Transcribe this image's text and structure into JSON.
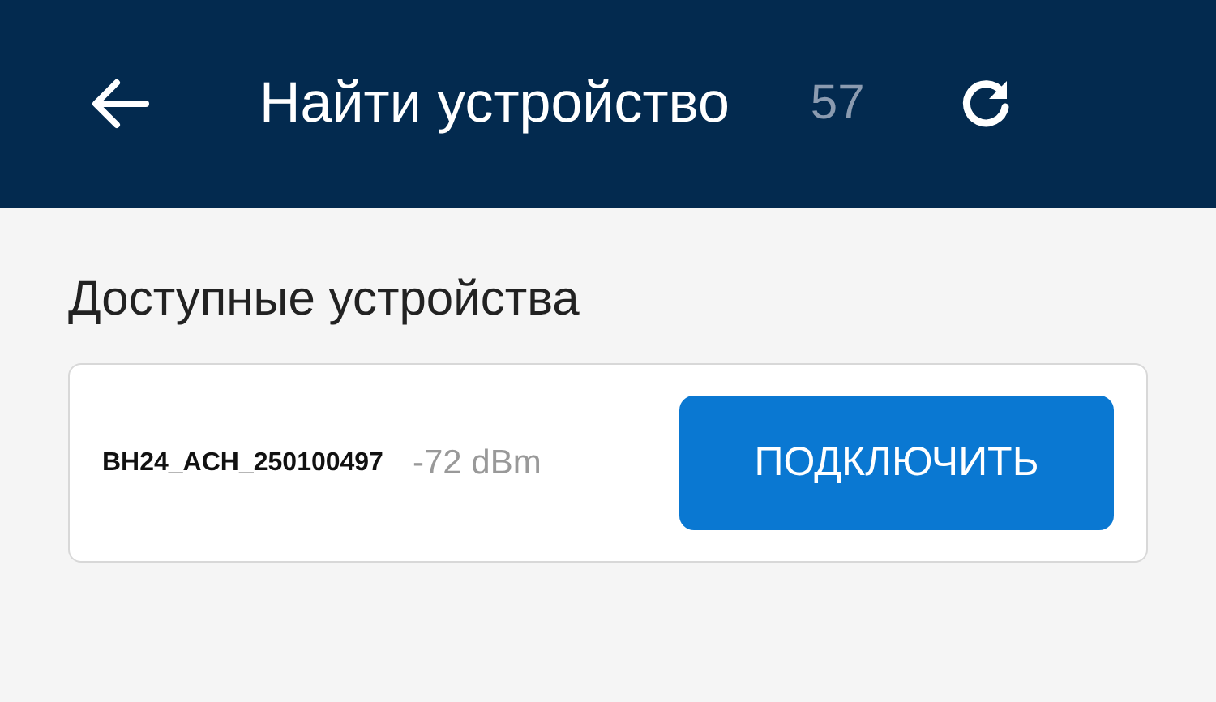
{
  "header": {
    "title": "Найти устройство",
    "count": "57"
  },
  "section_title": "Доступные устройства",
  "devices": [
    {
      "name": "BH24_ACH_250100497",
      "signal": "-72 dBm",
      "action": "ПОДКЛЮЧИТЬ"
    }
  ]
}
